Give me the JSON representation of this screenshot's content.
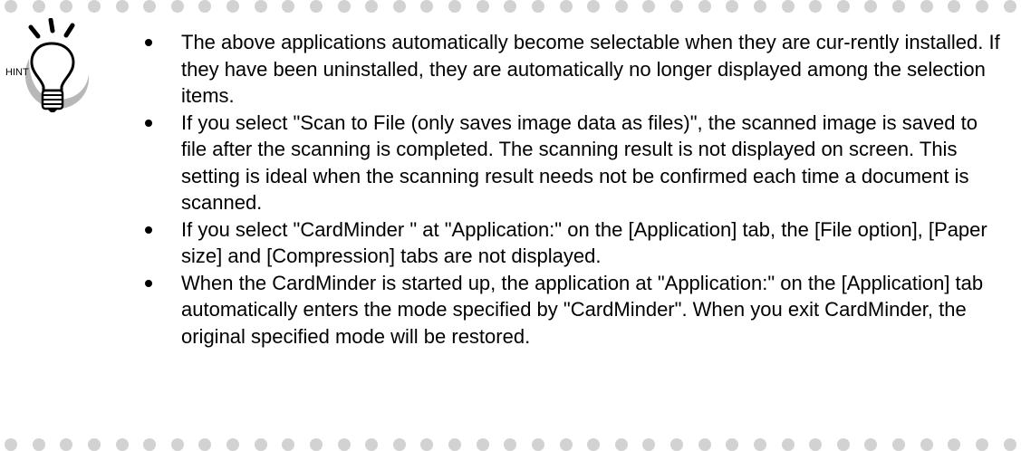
{
  "hint": {
    "label": "HINT",
    "icon": "light-bulb-icon"
  },
  "decoration": {
    "dot_color": "#d2d2d2"
  },
  "bullets": [
    "The above applications automatically become selectable when they are cur-rently installed. If they have been uninstalled, they are automatically no longer displayed among the selection items.",
    "If you select \"Scan to File (only saves image data as files)\", the scanned image is saved to file after the scanning is completed. The scanning result is not displayed on screen. This setting is ideal when the scanning result needs not be confirmed each time a document is scanned.",
    "If you select \"CardMinder \" at \"Application:\" on the [Application] tab, the [File option], [Paper size] and [Compression] tabs are not displayed.",
    "When the CardMinder is started up, the application at \"Application:\" on the [Application] tab automatically enters the mode specified by \"CardMinder\". When you exit CardMinder, the original specified mode will be restored."
  ]
}
